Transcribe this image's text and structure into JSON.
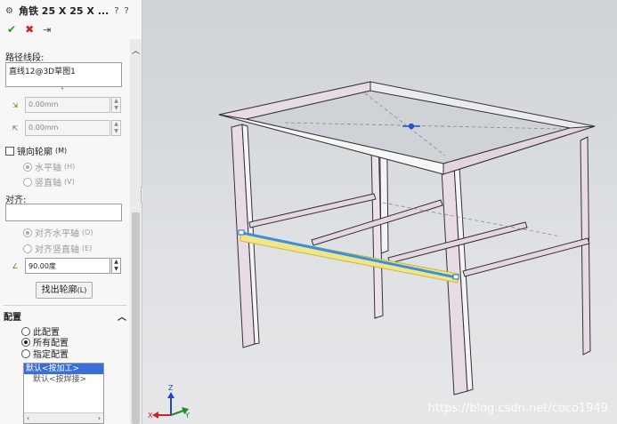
{
  "panel": {
    "title": "角铁 25 X 25 X ...",
    "help_icon": "?",
    "info_icon": "?",
    "ok": "✔",
    "cancel": "✖",
    "pin": "⇥",
    "path_label": "路径线段:",
    "path_value": "直线12@3D草图1",
    "angle_offset_1": "0.00mm",
    "angle_offset_2": "0.00mm",
    "mirror_label": "镜向轮廓",
    "mirror_shortcut": "(M)",
    "horizontal_axis": "水平轴",
    "horizontal_shortcut": "(H)",
    "vertical_axis": "竖直轴",
    "vertical_shortcut": "(V)",
    "align_label": "对齐:",
    "align_value": "",
    "align_horizontal": "对齐水平轴",
    "align_horizontal_shortcut": "(O)",
    "align_vertical": "对齐竖直轴",
    "align_vertical_shortcut": "(E)",
    "rotation_value": "90.00度",
    "find_profile": "找出轮廓",
    "find_profile_shortcut": "(L)",
    "config_label": "配置",
    "config_this": "此配置",
    "config_all": "所有配置",
    "config_specify": "指定配置",
    "config_items": [
      "默认<按加工>",
      "默认<按焊接>"
    ]
  },
  "viewport": {
    "triad_x": "X",
    "triad_y": "Y",
    "triad_z": "Z",
    "watermark": "https://blog.csdn.net/coco1949"
  }
}
